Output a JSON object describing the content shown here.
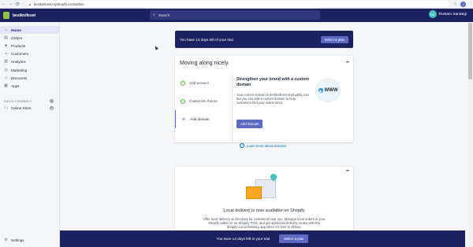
{
  "browser": {
    "url": "bestknifeset.myshopify.com/admin",
    "avatar": "J"
  },
  "topbar": {
    "store_name": "bestknifeset",
    "search_placeholder": "Search",
    "user_initials": "RS",
    "user_name": "Rustam Sandegi"
  },
  "sidebar": {
    "items": [
      {
        "label": "Home",
        "icon": "home-icon"
      },
      {
        "label": "Orders",
        "icon": "orders-icon"
      },
      {
        "label": "Products",
        "icon": "products-icon"
      },
      {
        "label": "Customers",
        "icon": "customers-icon"
      },
      {
        "label": "Analytics",
        "icon": "analytics-icon"
      },
      {
        "label": "Marketing",
        "icon": "marketing-icon"
      },
      {
        "label": "Discounts",
        "icon": "discounts-icon"
      },
      {
        "label": "Apps",
        "icon": "apps-icon"
      }
    ],
    "channels_heading": "SALES CHANNELS",
    "online_store": "Online Store",
    "settings": "Settings"
  },
  "trial_banner": {
    "text": "You have 14 days left of your trial",
    "button": "Select a plan"
  },
  "setup_card": {
    "title": "Moving along nicely.",
    "steps": [
      {
        "label": "Add product",
        "state": "done"
      },
      {
        "label": "Customize theme",
        "state": "done"
      },
      {
        "label": "Add domain",
        "state": "active"
      }
    ],
    "panel_title": "Strengthen your brand with a custom domain",
    "panel_description": "Your current domain is bestknifeset.myshopify.com but you can add a custom domain to help customers find your online store.",
    "panel_button": "Add domain",
    "learn_link": "Learn more about domains",
    "illustration_text": "WWW"
  },
  "delivery_card": {
    "headline": "Local delivery is now available on Shopify",
    "body": "Offer local delivery at checkout for customers near you. Manage local orders in your Shopify admin or on Shopify POS, and get optimized delivery routes with the Shopify Local Delivery app when it's time to deliver."
  },
  "bottom_banner": {
    "text": "You have 14 days left in your trial",
    "button": "Select a plan"
  },
  "colors": {
    "topbar": "#1c2260",
    "accent": "#5c6ac4",
    "success": "#50b83c"
  }
}
